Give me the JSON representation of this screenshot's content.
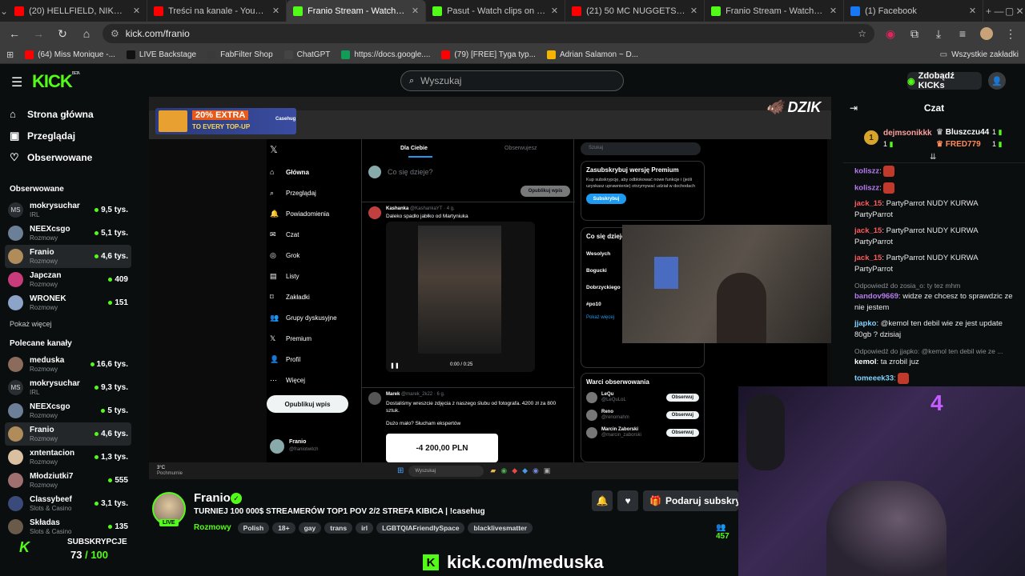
{
  "browser": {
    "tabs": [
      {
        "label": "(20) HELLFIELD, NIKO PANDETT",
        "color": "#ff0000",
        "active": false
      },
      {
        "label": "Treści na kanale - YouTube Stu",
        "color": "#ff0000",
        "active": false
      },
      {
        "label": "Franio Stream - Watch Live on",
        "color": "#53fc18",
        "active": true
      },
      {
        "label": "Pasut - Watch clips on Kick",
        "color": "#53fc18",
        "active": false
      },
      {
        "label": "(21) 50 MC NUGGETS CHALLE",
        "color": "#ff0000",
        "active": false
      },
      {
        "label": "Franio Stream - Watch Live on",
        "color": "#53fc18",
        "active": false
      },
      {
        "label": "(1) Facebook",
        "color": "#1877f2",
        "active": false
      }
    ],
    "new_tab": "+",
    "url": "kick.com/franio",
    "bookmarks": [
      {
        "label": "(64) Miss Monique -...",
        "color": "#ff0000"
      },
      {
        "label": "LIVE Backstage",
        "color": "#111111"
      },
      {
        "label": "FabFilter Shop",
        "color": "#3a3a3a"
      },
      {
        "label": "ChatGPT",
        "color": "#444444"
      },
      {
        "label": "https://docs.google....",
        "color": "#0f9d58"
      },
      {
        "label": "(79) [FREE] Tyga typ...",
        "color": "#ff0000"
      },
      {
        "label": "Adrian Salamon ~ D...",
        "color": "#f4b400"
      }
    ],
    "all_bookmarks": "Wszystkie zakładki"
  },
  "header": {
    "logo": "KICK",
    "logo_beta": "BETA",
    "search_placeholder": "Wyszukaj",
    "get_kicks": "Zdobądź KICKs"
  },
  "sidebar": {
    "nav": [
      {
        "label": "Strona główna",
        "icon": "home-icon"
      },
      {
        "label": "Przeglądaj",
        "icon": "browse-icon"
      },
      {
        "label": "Obserwowane",
        "icon": "heart-icon"
      }
    ],
    "followed_title": "Obserwowane",
    "followed": [
      {
        "name": "mokrysuchar",
        "category": "IRL",
        "viewers": "9,5 tys.",
        "avatar": "MS",
        "color": "#2a2e33"
      },
      {
        "name": "NEEXcsgo",
        "category": "Rozmowy",
        "viewers": "5,1 tys.",
        "avatar": "",
        "color": "#6b7f99"
      },
      {
        "name": "Franio",
        "category": "Rozmowy",
        "viewers": "4,6 tys.",
        "avatar": "",
        "color": "#b08c5a",
        "selected": true
      },
      {
        "name": "Japczan",
        "category": "Rozmowy",
        "viewers": "409",
        "avatar": "",
        "color": "#c93b7a"
      },
      {
        "name": "WRONEK",
        "category": "Rozmowy",
        "viewers": "151",
        "avatar": "",
        "color": "#8da4c9"
      }
    ],
    "show_more": "Pokaż więcej",
    "recommended_title": "Polecane kanały",
    "recommended": [
      {
        "name": "meduska",
        "category": "Rozmowy",
        "viewers": "16,6 tys.",
        "avatar": "",
        "color": "#8a6b5c"
      },
      {
        "name": "mokrysuchar",
        "category": "IRL",
        "viewers": "9,3 tys.",
        "avatar": "MS",
        "color": "#2a2e33"
      },
      {
        "name": "NEEXcsgo",
        "category": "Rozmowy",
        "viewers": "5 tys.",
        "avatar": "",
        "color": "#6b7f99"
      },
      {
        "name": "Franio",
        "category": "Rozmowy",
        "viewers": "4,6 tys.",
        "avatar": "",
        "color": "#b08c5a",
        "selected": true
      },
      {
        "name": "xntentacion",
        "category": "Rozmowy",
        "viewers": "1,3 tys.",
        "avatar": "",
        "color": "#d8c0a0"
      },
      {
        "name": "Młodziutki7",
        "category": "Rozmowy",
        "viewers": "555",
        "avatar": "",
        "color": "#a07070"
      },
      {
        "name": "Classybeef",
        "category": "Slots & Casino",
        "viewers": "3,1 tys.",
        "avatar": "",
        "color": "#3a4a7a"
      },
      {
        "name": "Składas",
        "category": "Slots & Casino",
        "viewers": "135",
        "avatar": "",
        "color": "#6a5a4a"
      }
    ]
  },
  "overlay": {
    "promo_badge": "20% EXTRA",
    "promo_sub": "TO EVERY TOP-UP",
    "promo_brand": "Casehug",
    "sponsor": "DZIK",
    "subs_label": "SUBSKRYPCJE",
    "subs_count": "73",
    "subs_goal": "/ 100",
    "footer_url_a": "kick.com/",
    "footer_url_b": "meduska"
  },
  "screen": {
    "x_nav": [
      "Główna",
      "Przeglądaj",
      "Powiadomienia",
      "Czat",
      "Grok",
      "Listy",
      "Zakładki",
      "Grupy dyskusyjne",
      "Premium",
      "Profil",
      "Więcej"
    ],
    "x_post_button": "Opublikuj wpis",
    "x_profile_name": "Franio",
    "x_profile_handle": "@franiotwitch",
    "tab_for_you": "Dla Ciebie",
    "tab_following": "Obserwujesz",
    "compose_placeholder": "Co się dzieje?",
    "compose_button": "Opublikuj wpis",
    "post1_author": "Kashanka",
    "post1_handle": "@KashankaYT · 4 g.",
    "post1_text": "Daleko spadło jabłko od Martyniuka",
    "video_time": "0:00 / 0:25",
    "post2_author": "Marek",
    "post2_handle": "@marek_2k22 · 6 g.",
    "post2_text": "Dostaliśmy wreszcie zdjęcia z naszego ślubu od fotografa. 4200 zł za 800 sztuk.",
    "post2_text2": "Dużo mało? Słucham ekspertów",
    "post2_price": "-4 200,00 PLN",
    "premium_title": "Zasubskrybuj wersję Premium",
    "premium_text": "Kup subskrypcję, aby odblokować nowe funkcje i (jeśli uzyskasz uprawnienie) otrzymywać udział w dochodach",
    "premium_button": "Subskrybuj",
    "trends_title": "Co się dzieje",
    "trends": [
      "Wesolych",
      "Bogucki",
      "Dobrzyckiego",
      "#po10"
    ],
    "show_more": "Pokaż więcej",
    "follow_title": "Warci obserwowania",
    "follow_people": [
      {
        "name": "LeQu",
        "handle": "@LeQuLoL"
      },
      {
        "name": "Reno",
        "handle": "@renomahm"
      },
      {
        "name": "Marcin Zaborski",
        "handle": "@marcin_zaborski"
      }
    ],
    "follow_button": "Obserwuj",
    "search_x": "Szukaj",
    "taskbar_search": "Wyszukaj",
    "weather": "3°C",
    "weather_sub": "Pochmurnie"
  },
  "chat": {
    "title": "Czat",
    "leaders": [
      {
        "name": "dejmsonikkk",
        "count": "1"
      },
      {
        "name": "Bluszczu44",
        "count": "1"
      },
      {
        "name": "FRED779",
        "count": "1"
      }
    ],
    "messages": [
      {
        "user": "koliszz",
        "color": "#b67cf0",
        "text": ""
      },
      {
        "user": "koliszz",
        "color": "#b67cf0",
        "text": ""
      },
      {
        "user": "jack_15",
        "color": "#ff5a5a",
        "text": "PartyParrot  NUDY KURWA PartyParrot"
      },
      {
        "user": "jack_15",
        "color": "#ff5a5a",
        "text": "PartyParrot  NUDY KURWA PartyParrot"
      },
      {
        "user": "jack_15",
        "color": "#ff5a5a",
        "text": "PartyParrot  NUDY KURWA PartyParrot"
      },
      {
        "reply": "Odpowiedź do zosia_o: ty tez mhm",
        "user": "bandov9669",
        "color": "#b67cf0",
        "text": "widze ze chcesz to sprawdzic ze nie jestem"
      },
      {
        "user": "jjapko",
        "color": "#7fd3ff",
        "text": "@kemol ten debil wie ze jest update 80gb ? dzisiaj"
      },
      {
        "reply": "Odpowiedź do jjapko: @kemol ten debil wie ze ...",
        "user": "kemol",
        "color": "#ffffff",
        "text": "ta zrobil juz"
      },
      {
        "user": "tomeeek33",
        "color": "#7fd3ff",
        "text": ""
      }
    ]
  },
  "stream": {
    "streamer": "Franio",
    "live": "LIVE",
    "title": "TURNIEJ 100 000$ STREAMERÓW TOP1 POV 2/2 STREFA KIBICA | !casehug",
    "category": "Rozmowy",
    "tags": [
      "Polish",
      "18+",
      "gay",
      "trans",
      "irl",
      "LGBTQIAFriendlySpace",
      "blacklivesmatter"
    ],
    "subscribe": "Podaruj subskrypcję",
    "viewers": "457"
  }
}
